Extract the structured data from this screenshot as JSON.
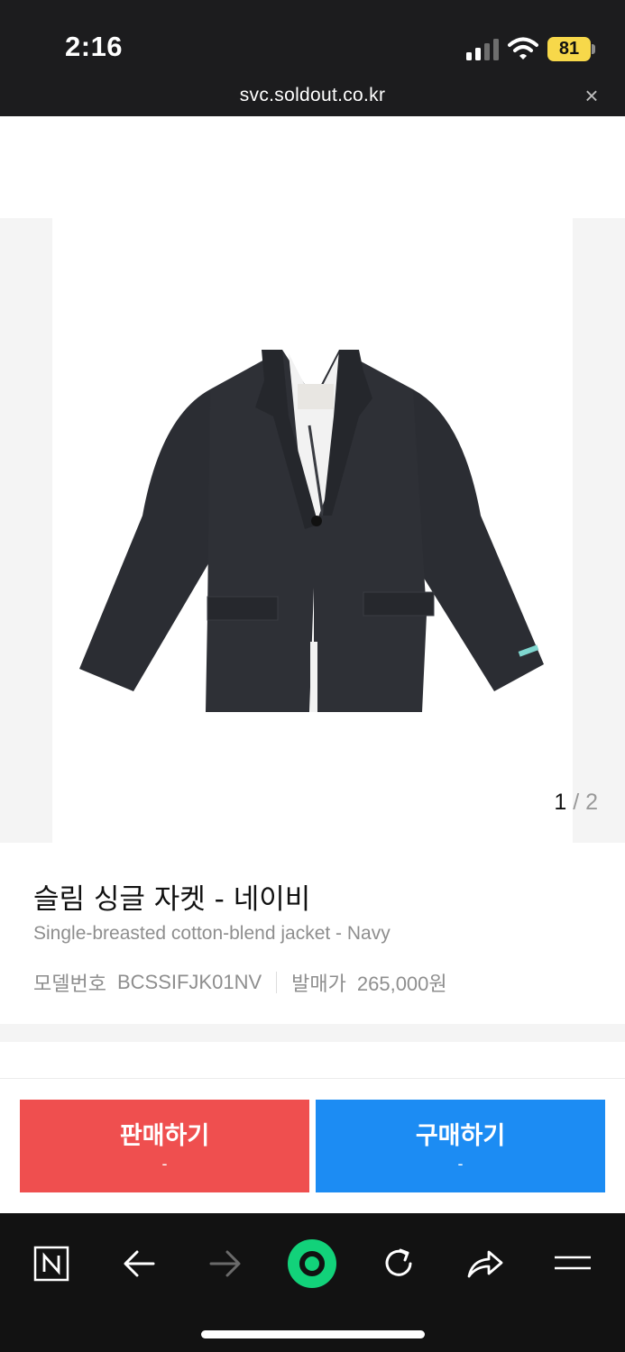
{
  "status_bar": {
    "time": "2:16",
    "battery": "81"
  },
  "browser": {
    "url": "svc.soldout.co.kr",
    "close_symbol": "×"
  },
  "gallery": {
    "current": "1",
    "separator": " / ",
    "total": "2"
  },
  "product": {
    "name_ko": "슬림 싱글 자켓 - 네이비",
    "name_en": "Single-breasted cotton-blend jacket - Navy",
    "model_label": "모델번호",
    "model_number": "BCSSIFJK01NV",
    "price_label": "발매가",
    "release_price": "265,000원"
  },
  "actions": {
    "sell_label": "판매하기",
    "sell_price": "-",
    "buy_label": "구매하기",
    "buy_price": "-"
  },
  "colors": {
    "sell": "#ef4f4f",
    "buy": "#1c8cf3",
    "bar": "#1c1c1e",
    "accent_green": "#12d27a"
  },
  "bottom_nav": [
    "naver-n-icon",
    "back-arrow-icon",
    "forward-arrow-icon",
    "green-home-icon",
    "reload-icon",
    "share-icon",
    "menu-icon"
  ]
}
